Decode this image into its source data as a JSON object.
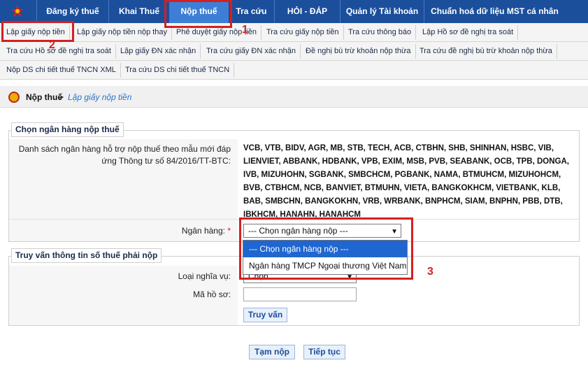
{
  "top_nav": {
    "items": [
      "Đăng ký thuế",
      "Khai Thuế",
      "Nộp thuế",
      "Tra cứu",
      "HỎI - ĐÁP",
      "Quản lý Tài khoản",
      "Chuẩn hoá dữ liệu MST cá nhân"
    ],
    "active": "Nộp thuế"
  },
  "sub_nav": {
    "row1": [
      "Lập giấy nộp tiền",
      "Lập giấy nộp tiền nộp thay",
      "Phê duyệt giấy nộp tiền",
      "Tra cứu giấy nộp tiền",
      "Tra cứu thông báo",
      "Lập Hồ sơ đề nghị tra soát"
    ],
    "row2": [
      "Tra cứu Hồ sơ đề nghị tra soát",
      "Lập giấy ĐN xác nhận",
      "Tra cứu giấy ĐN xác nhận",
      "Đề nghị bù trừ khoản nộp thừa",
      "Tra cứu đề nghị bù trừ khoản nộp thừa"
    ],
    "row3": [
      "Nộp DS chi tiết thuế TNCN XML",
      "Tra cứu DS chi tiết thuế TNCN"
    ]
  },
  "breadcrumb": {
    "main": "Nộp thuế",
    "sep": ">",
    "sub": "Lập giấy nộp tiền"
  },
  "bank_section": {
    "legend": "Chọn ngân hàng nộp thuế",
    "list_label": "Danh sách ngân hàng hỗ trợ nộp thuế theo mẫu mới đáp ứng Thông tư số 84/2016/TT-BTC:",
    "bank_list": "VCB, VTB, BIDV, AGR, MB, STB, TECH, ACB, CTBHN, SHB, SHINHAN, HSBC, VIB, LIENVIET, ABBANK, HDBANK, VPB, EXIM, MSB, PVB, SEABANK, OCB, TPB, DONGA, IVB, MIZUHOHN, SGBANK, SMBCHCM, PGBANK, NAMA, BTMUHCM, MIZUHOHCM, BVB, CTBHCM, NCB, BANVIET, BTMUHN, VIETA, BANGKOKHCM, VIETBANK, KLB, BAB, SMBCHN, BANGKOKHN, VRB, WRBANK, BNPHCM, SIAM, BNPHN, PBB, DTB, IBKHCM, HANAHN, HANAHCM",
    "bank_label": "Ngân hàng:",
    "required_mark": "*",
    "bank_select_value": "--- Chọn ngân hàng nộp ---",
    "dropdown_options": [
      "--- Chọn ngân hàng nộp ---",
      "Ngân hàng TMCP Ngoại thương Việt Nam"
    ]
  },
  "query_section": {
    "legend": "Truy vấn thông tin số thuế phải nộp",
    "obligation_label": "Loại nghĩa vụ:",
    "obligation_value": "Chọn",
    "dossier_label": "Mã hồ sơ:",
    "dossier_value": "",
    "query_button": "Truy vấn"
  },
  "actions": {
    "save_draft": "Tạm nộp",
    "continue": "Tiếp tục"
  },
  "annotations": {
    "n1": "1",
    "n2": "2",
    "n3": "3"
  },
  "colors": {
    "nav_bg": "#1b4f9c",
    "nav_active": "#3d7fd6",
    "highlight_red": "#d42020",
    "dropdown_selected": "#1f66d1"
  }
}
